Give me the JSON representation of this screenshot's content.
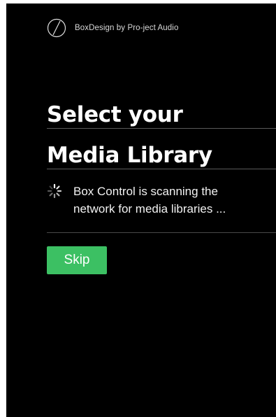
{
  "brand": {
    "logo_icon": "project-audio-logo-icon",
    "text": "BoxDesign by Pro-ject Audio"
  },
  "title": {
    "line1": "Select your",
    "line2": "Media Library"
  },
  "scan": {
    "icon": "loading-spinner-icon",
    "line1": "Box Control is scanning the",
    "line2": "network for media libraries ..."
  },
  "actions": {
    "skip_label": "Skip"
  },
  "colors": {
    "background": "#000000",
    "accent": "#3cc063",
    "text": "#ffffff",
    "divider": "#5a5a5a"
  }
}
